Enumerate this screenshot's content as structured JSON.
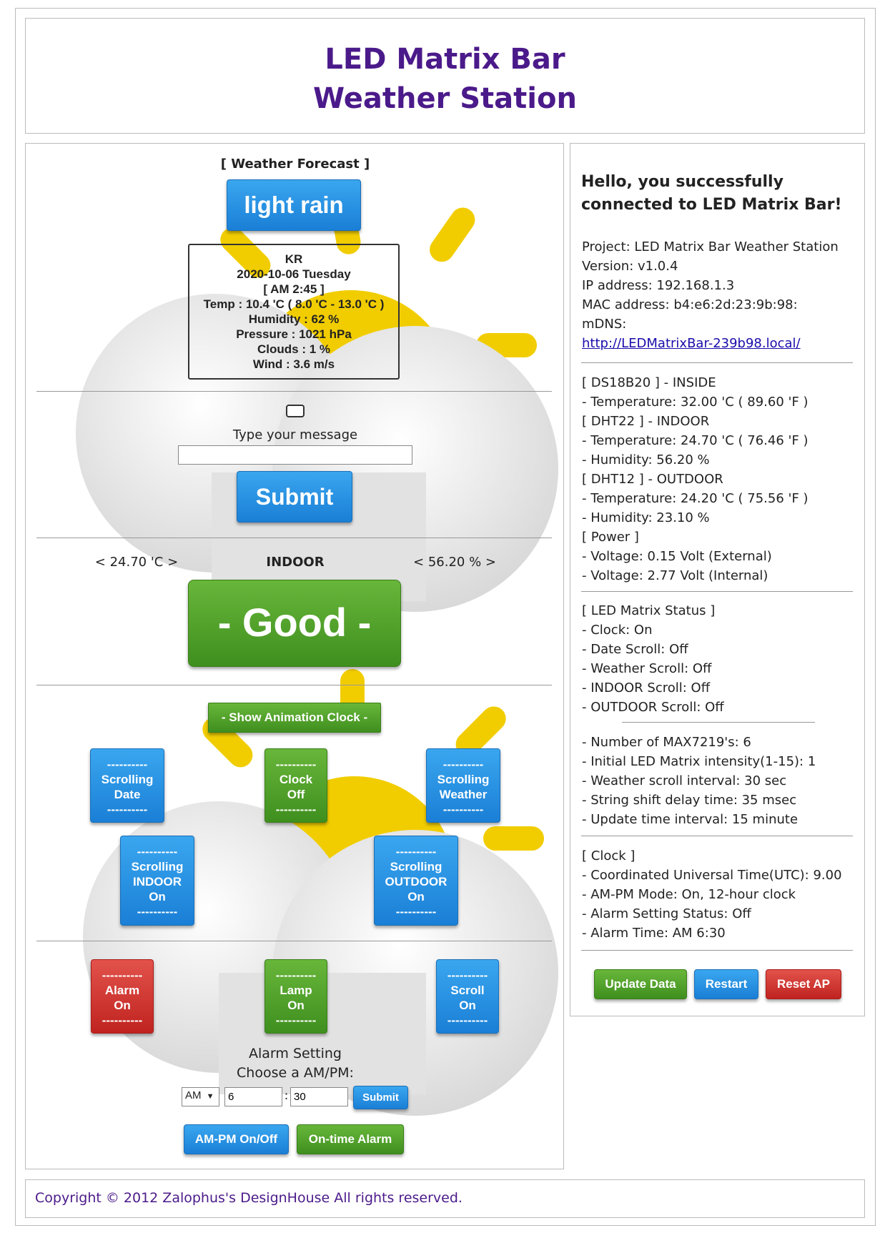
{
  "header": {
    "title_line1": "LED Matrix Bar",
    "title_line2": "Weather Station"
  },
  "forecast": {
    "heading": "[ Weather Forecast ]",
    "button": "light rain",
    "lines": [
      "KR",
      "2020-10-06 Tuesday",
      "[ AM 2:45 ]",
      "Temp : 10.4 'C ( 8.0 'C - 13.0 'C )",
      "Humidity : 62 %",
      "Pressure : 1021 hPa",
      "Clouds : 1 %",
      "Wind : 3.6 m/s"
    ]
  },
  "message": {
    "label": "Type your message",
    "value": "",
    "submit": "Submit"
  },
  "indoor": {
    "temp": "< 24.70 'C >",
    "label": "INDOOR",
    "humidity": "< 56.20 % >",
    "status": "- Good -"
  },
  "controls": {
    "show_clock": "- Show Animation Clock -",
    "scrolling_date": "----------\nScrolling\nDate\n----------",
    "clock": "----------\nClock\nOff\n----------",
    "scrolling_weather": "----------\nScrolling\nWeather\n----------",
    "scrolling_indoor": "----------\nScrolling\nINDOOR\nOn\n----------",
    "scrolling_outdoor": "----------\nScrolling\nOUTDOOR\nOn\n----------",
    "alarm": "----------\nAlarm\nOn\n----------",
    "lamp": "----------\nLamp\nOn\n----------",
    "scroll": "----------\nScroll\nOn\n----------"
  },
  "alarm_setting": {
    "title": "Alarm Setting",
    "subtitle": "Choose a AM/PM:",
    "ampm": "AM",
    "hour": "6",
    "separator": ":",
    "minute": "30",
    "submit": "Submit",
    "ampm_toggle": "AM-PM On/Off",
    "ontime_alarm": "On-time Alarm"
  },
  "info": {
    "greeting": "Hello, you successfully connected to LED Matrix Bar!",
    "project": [
      "Project: LED Matrix Bar Weather Station",
      "Version: v1.0.4",
      "IP address: 192.168.1.3",
      "MAC address: b4:e6:2d:23:9b:98:",
      "mDNS:"
    ],
    "mdns_link": "http://LEDMatrixBar-239b98.local/",
    "sensors": [
      "[ DS18B20 ] - INSIDE",
      "- Temperature: 32.00 'C ( 89.60 'F )",
      "[ DHT22 ] - INDOOR",
      "- Temperature: 24.70 'C ( 76.46 'F )",
      "- Humidity: 56.20 %",
      "[ DHT12 ] - OUTDOOR",
      "- Temperature: 24.20 'C ( 75.56 'F )",
      "- Humidity: 23.10 %",
      "[ Power ]",
      "- Voltage: 0.15 Volt (External)",
      "- Voltage: 2.77 Volt (Internal)"
    ],
    "matrix_status": [
      "[ LED Matrix Status ]",
      "- Clock: On",
      "- Date Scroll: Off",
      "- Weather Scroll: Off",
      "- INDOOR Scroll: Off",
      "- OUTDOOR Scroll: Off"
    ],
    "matrix_config": [
      "- Number of MAX7219's: 6",
      "- Initial LED Matrix intensity(1-15): 1",
      "- Weather scroll interval: 30 sec",
      "- String shift delay time: 35 msec",
      "- Update time interval: 15 minute"
    ],
    "clock": [
      "[ Clock ]",
      "- Coordinated Universal Time(UTC): 9.00",
      "- AM-PM Mode: On, 12-hour clock",
      "- Alarm Setting Status: Off",
      "- Alarm Time: AM 6:30"
    ],
    "buttons": {
      "update": "Update Data",
      "restart": "Restart",
      "reset": "Reset AP"
    }
  },
  "footer": {
    "copyright": "Copyright © 2012 Zalophus's DesignHouse All rights reserved."
  }
}
